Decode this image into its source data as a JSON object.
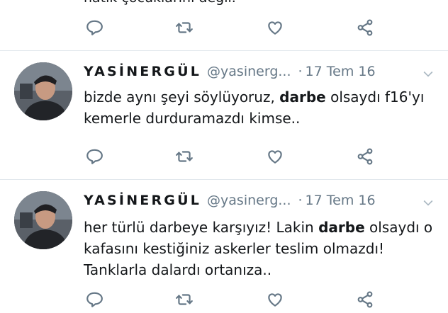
{
  "top_partial_text": "hatik çocuklarını değil.",
  "icons": [
    "reply-icon",
    "retweet-icon",
    "like-icon",
    "share-icon",
    "caret-down-icon"
  ],
  "colors": {
    "icon": "#657786",
    "divider": "#e1e8ed",
    "muted_text": "#657786",
    "text": "#14171a"
  },
  "tweets": [
    {
      "name": "YASİNERGÜL",
      "handle": "@yasinerg...",
      "separator": "·",
      "time": "17 Tem 16",
      "text_before": "bizde aynı şeyi söylüyoruz, ",
      "bold": "darbe",
      "text_after": " olsaydı f16'yı kemerle durduramazdı kimse.."
    },
    {
      "name": "YASİNERGÜL",
      "handle": "@yasinerg...",
      "separator": "·",
      "time": "17 Tem 16",
      "text_before": "her türlü darbeye karşıyız! Lakin ",
      "bold": "darbe",
      "text_after": " olsaydı o kafasını kestiğiniz askerler teslim olmazdı! Tanklarla dalardı ortanıza.."
    }
  ]
}
